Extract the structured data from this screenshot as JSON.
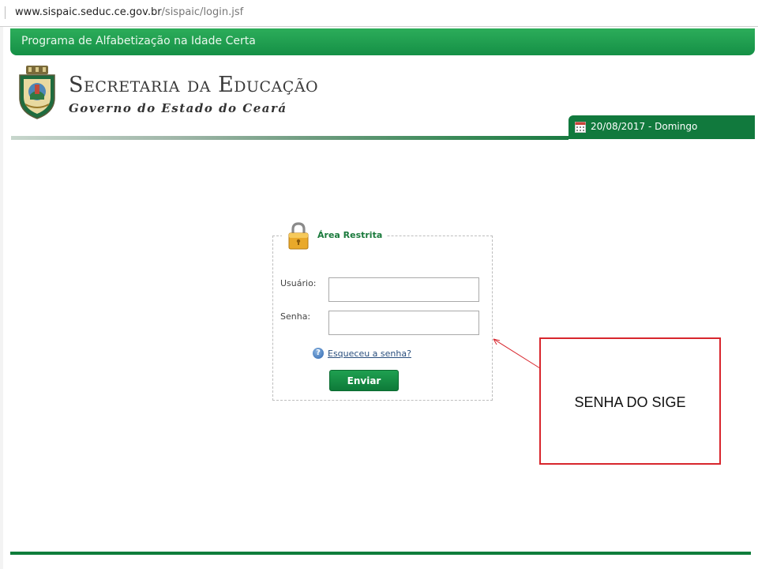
{
  "browser": {
    "url_host": "www.sispaic.seduc.ce.gov.br",
    "url_path": "/sispaic/login.jsf"
  },
  "header": {
    "program_title": "Programa de Alfabetização na Idade Certa",
    "org_title": "Secretaria da Educação",
    "org_subtitle": "Governo do Estado do Ceará",
    "date_text": "20/08/2017 - Domingo",
    "date_icon": "calendar-icon",
    "crest_icon": "state-coat-of-arms"
  },
  "login": {
    "title": "Área Restrita",
    "lock_icon": "lock-icon",
    "user_label": "Usuário:",
    "user_value": "",
    "password_label": "Senha:",
    "password_value": "",
    "help_icon": "question-icon",
    "forgot_link": "Esqueceu a senha?",
    "submit_label": "Enviar"
  },
  "annotation": {
    "text": "SENHA DO SIGE"
  },
  "colors": {
    "brand_green": "#159046",
    "dark_green": "#11793d",
    "annotation_red": "#d8262d",
    "link_blue": "#2a4f7e"
  }
}
